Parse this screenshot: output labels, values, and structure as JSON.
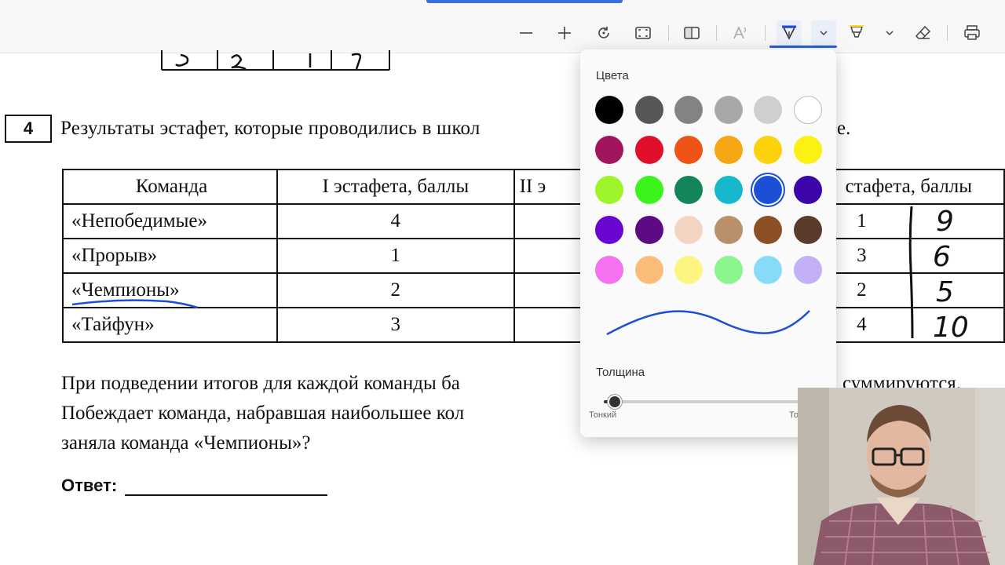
{
  "toolbar": {
    "zoom_out_icon": "minus-icon",
    "zoom_in_icon": "plus-icon",
    "rotate_icon": "rotate-icon",
    "fit_icon": "fit-page-icon",
    "view_icon": "two-page-icon",
    "read_aloud_icon": "read-aloud-icon",
    "draw_icon": "pen-icon",
    "highlight_icon": "highlighter-icon",
    "erase_icon": "eraser-icon",
    "print_icon": "printer-icon"
  },
  "task": {
    "number": "4",
    "heading_start": "Результаты эстафет, которые проводились в школ",
    "heading_end": "е.",
    "table": {
      "headers": [
        "Команда",
        "I эстафета, баллы",
        "II э",
        "стафета, баллы"
      ],
      "rows": [
        {
          "team": "«Непобедимые»",
          "r1": "4",
          "r4": "1",
          "sum": "9"
        },
        {
          "team": "«Прорыв»",
          "r1": "1",
          "r4": "3",
          "sum": "6"
        },
        {
          "team": "«Чемпионы»",
          "r1": "2",
          "r4": "2",
          "sum": "5"
        },
        {
          "team": "«Тайфун»",
          "r1": "3",
          "r4": "4",
          "sum": "10"
        }
      ]
    },
    "paragraph": {
      "line1_a": "При подведении итогов для каждой команды ба",
      "line1_b": "суммируются.",
      "line2": "Побеждает команда, набравшая наибольшее кол",
      "line3": "заняла команда «Чемпионы»?"
    },
    "answer_label": "Ответ:"
  },
  "color_panel": {
    "title": "Цвета",
    "colors": [
      "#000000",
      "#575757",
      "#838383",
      "#a8a8a8",
      "#cfcfcf",
      "#ffffff",
      "#a1155d",
      "#e0102a",
      "#ee5416",
      "#f5a612",
      "#fbd20c",
      "#fdf113",
      "#9df42a",
      "#3af41c",
      "#14845a",
      "#16b8cc",
      "#1c4fd6",
      "#3b05a9",
      "#6906cf",
      "#5c0b84",
      "#f3d4c2",
      "#b8916a",
      "#8b5026",
      "#5b3a2b",
      "#f472f0",
      "#fbbd79",
      "#fdf582",
      "#8cf58e",
      "#88dbf7",
      "#c3b0f6"
    ],
    "selected_index": 16,
    "preview_color": "#1c4fd6",
    "thickness_title": "Толщина",
    "thin_label": "Тонкий",
    "thick_label": "То",
    "thickness_level": 0.05
  }
}
